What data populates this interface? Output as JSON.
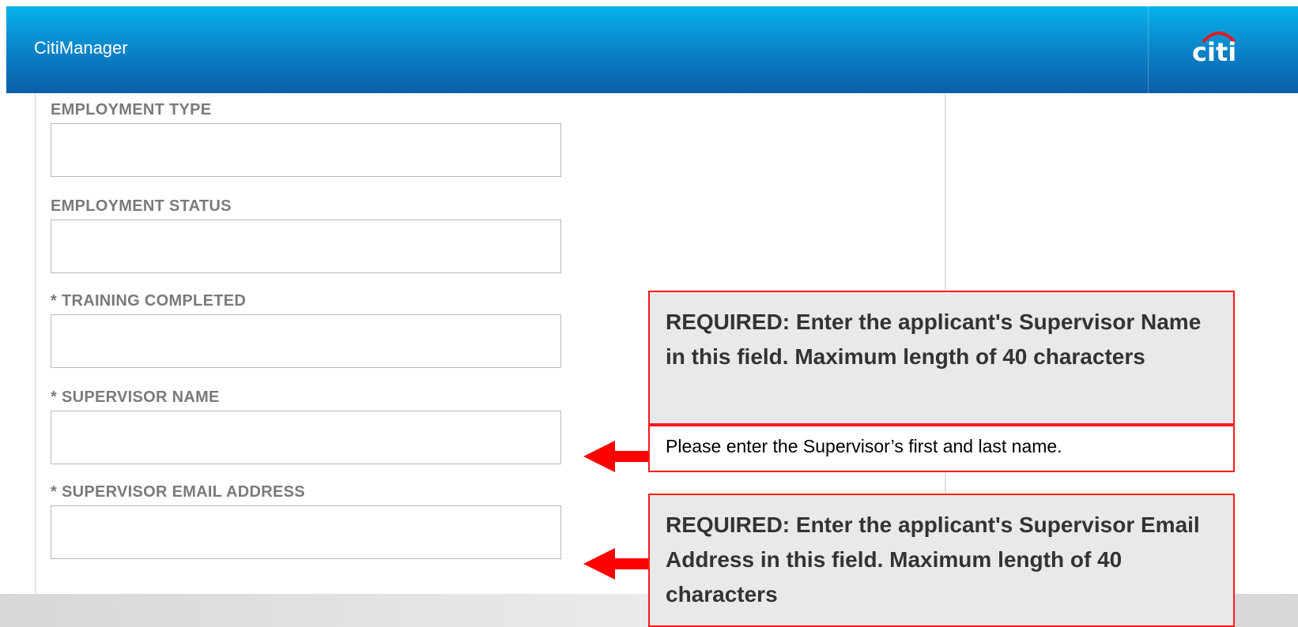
{
  "header": {
    "app_title": "CitiManager",
    "logo_text": "citi"
  },
  "form": {
    "fields": [
      {
        "label": "EMPLOYMENT TYPE",
        "value": ""
      },
      {
        "label": "EMPLOYMENT STATUS",
        "value": ""
      },
      {
        "label": "* TRAINING COMPLETED",
        "value": ""
      },
      {
        "label": "* SUPERVISOR NAME",
        "value": ""
      },
      {
        "label": "* SUPERVISOR EMAIL ADDRESS",
        "value": ""
      }
    ]
  },
  "annotations": {
    "supervisor_name_tip": "REQUIRED: Enter the applicant's Supervisor Name in this field. Maximum length of 40 characters",
    "supervisor_name_note": "Please enter the Supervisor’s first and last name.",
    "supervisor_email_tip": "REQUIRED: Enter the applicant's Supervisor Email Address in this field. Maximum length of 40 characters"
  },
  "colors": {
    "header_top": "#07b3ea",
    "header_bottom": "#0b5ea8",
    "callout_border": "#ff1b1b",
    "arrow": "#ff0000",
    "label_text": "#7a7a7a"
  }
}
